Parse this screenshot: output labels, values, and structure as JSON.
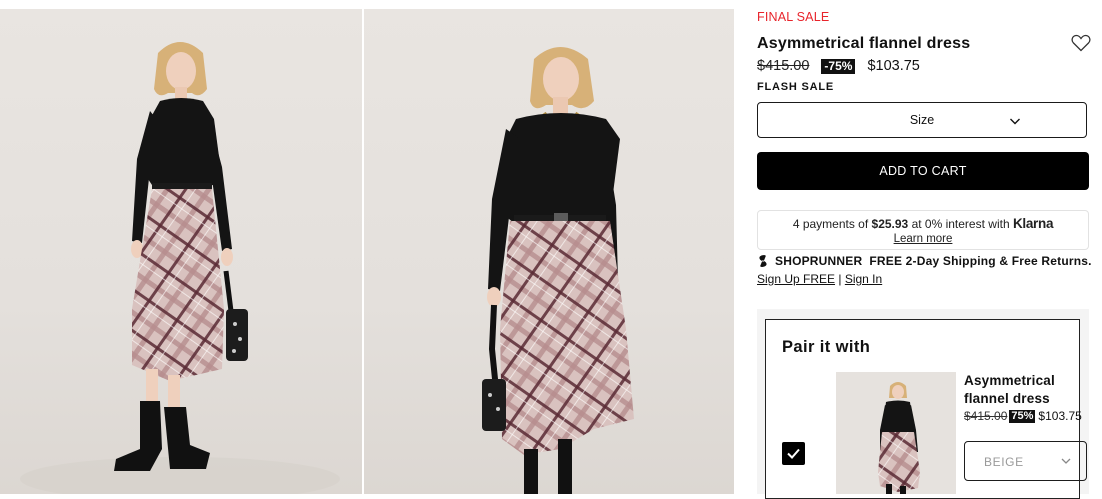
{
  "product": {
    "sale_tag": "FINAL SALE",
    "title": "Asymmetrical flannel dress",
    "original_price": "$415.00",
    "discount": "-75%",
    "sale_price": "$103.75",
    "flash_label": "FLASH SALE",
    "size_label": "Size",
    "add_to_cart_label": "ADD TO CART"
  },
  "klarna": {
    "prefix": "4 payments of ",
    "amount": "$25.93",
    "middle": " at 0% interest with ",
    "brand": "Klarna",
    "learn_more": "Learn more"
  },
  "shoprunner": {
    "brand": "SHOPRUNNER",
    "message": "FREE 2-Day Shipping & Free Returns.",
    "signup": "Sign Up FREE",
    "separator": " | ",
    "signin": "Sign In"
  },
  "pair": {
    "heading": "Pair it with",
    "item_name": "Asymmetrical flannel dress",
    "original_price": "$415.00",
    "discount": "75%",
    "sale_price": "$103.75",
    "color_value": "BEIGE",
    "checked": true
  },
  "colors": {
    "sale_red": "#e8242b",
    "button_black": "#000000",
    "plaid_pink": "#c9a9a7",
    "plaid_burgundy": "#5a2a35"
  },
  "icons": [
    "heart-icon",
    "chevron-down-icon",
    "shoprunner-icon",
    "checkmark-icon"
  ]
}
